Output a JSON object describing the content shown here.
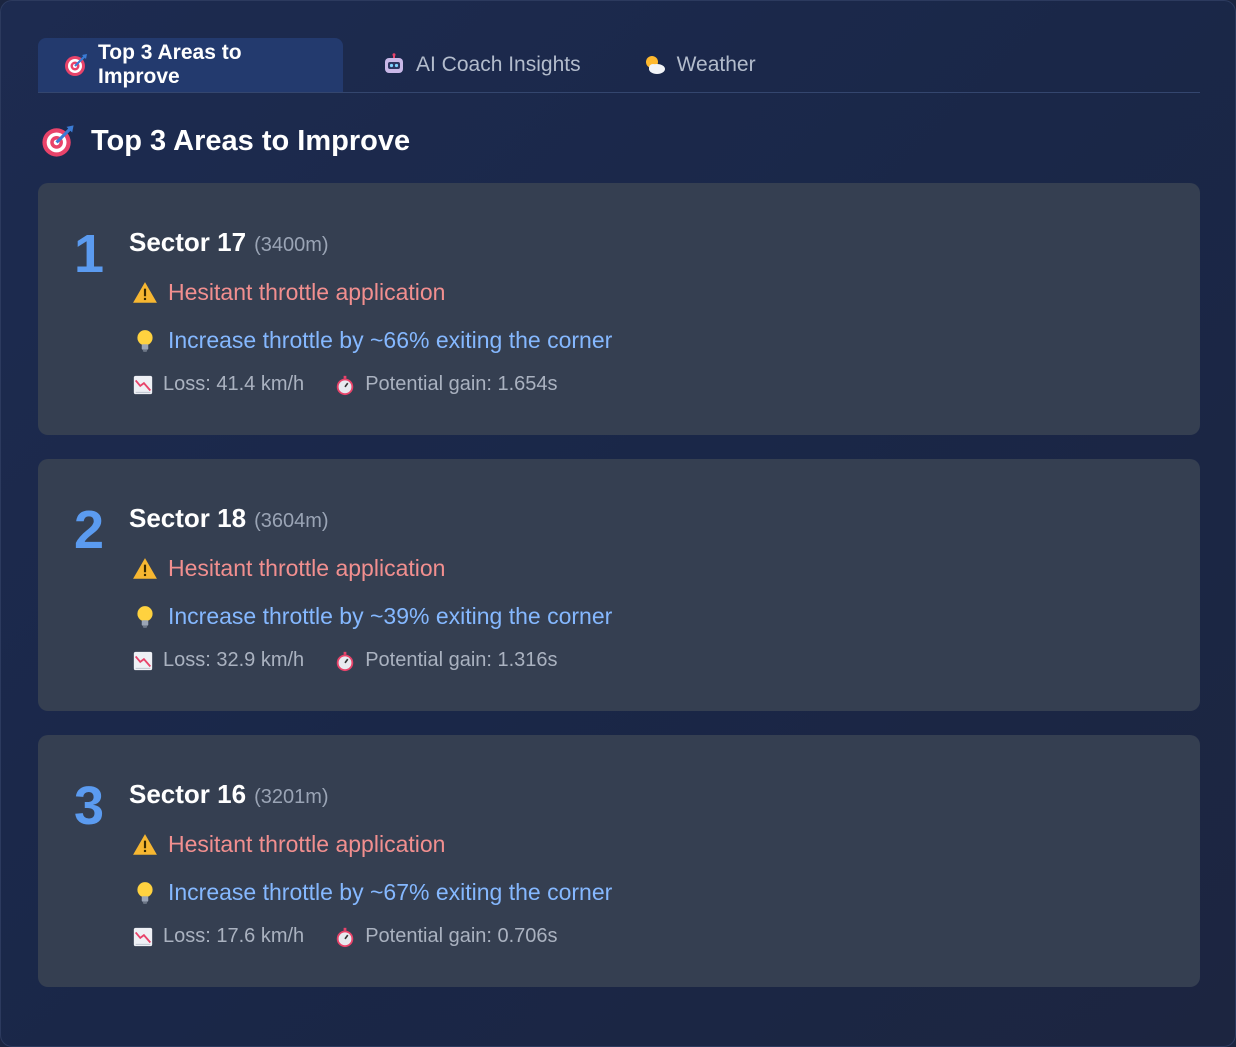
{
  "tabs": [
    {
      "label": "Top 3 Areas to Improve",
      "icon": "target-icon",
      "active": true
    },
    {
      "label": "AI Coach Insights",
      "icon": "robot-icon",
      "active": false
    },
    {
      "label": "Weather",
      "icon": "sun-cloud-icon",
      "active": false
    }
  ],
  "heading": "Top 3 Areas to Improve",
  "colors": {
    "accent": "#5b9bf0",
    "issue": "#f28f8f",
    "tip": "#85b8ff",
    "card": "#353f51"
  },
  "areas": [
    {
      "rank": "1",
      "sector": "Sector 17",
      "distance": "(3400m)",
      "issue": "Hesitant throttle application",
      "tip": "Increase throttle by ~66% exiting the corner",
      "loss": "Loss: 41.4 km/h",
      "gain": "Potential gain: 1.654s"
    },
    {
      "rank": "2",
      "sector": "Sector 18",
      "distance": "(3604m)",
      "issue": "Hesitant throttle application",
      "tip": "Increase throttle by ~39% exiting the corner",
      "loss": "Loss: 32.9 km/h",
      "gain": "Potential gain: 1.316s"
    },
    {
      "rank": "3",
      "sector": "Sector 16",
      "distance": "(3201m)",
      "issue": "Hesitant throttle application",
      "tip": "Increase throttle by ~67% exiting the corner",
      "loss": "Loss: 17.6 km/h",
      "gain": "Potential gain: 0.706s"
    }
  ]
}
